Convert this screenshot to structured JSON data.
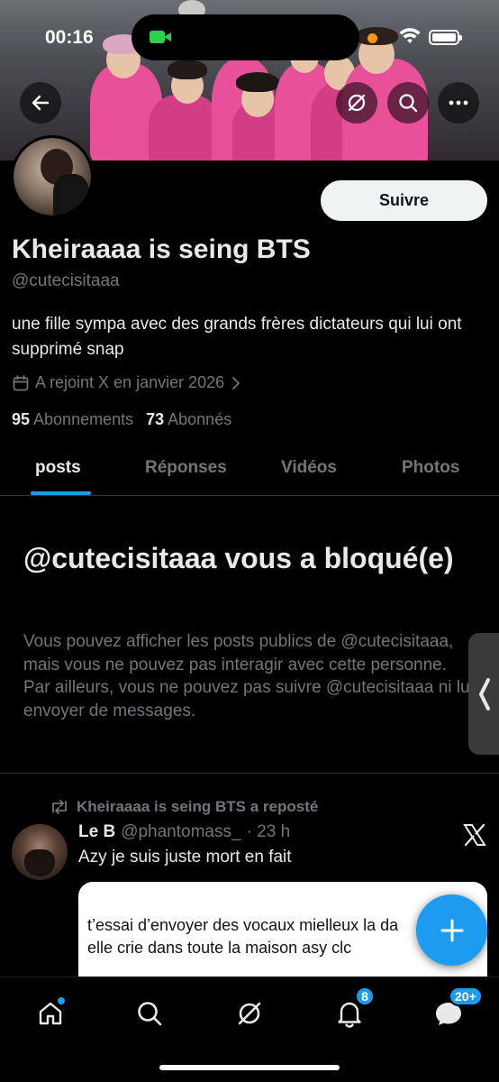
{
  "status_bar": {
    "time": "00:16"
  },
  "profile": {
    "display_name": "Kheiraaaa is seing BTS",
    "handle": "@cutecisitaaa",
    "bio": "une fille sympa avec des grands frères dictateurs qui lui ont supprimé snap",
    "joined": "A rejoint X en janvier 2026",
    "following_count": "95",
    "following_label": "Abonnements",
    "followers_count": "73",
    "followers_label": "Abonnés",
    "follow_button": "Suivre"
  },
  "tabs": [
    {
      "label": "posts",
      "active": true
    },
    {
      "label": "Réponses",
      "active": false
    },
    {
      "label": "Vidéos",
      "active": false
    },
    {
      "label": "Photos",
      "active": false
    }
  ],
  "blocked": {
    "title": "@cutecisitaaa vous a bloqué(e)",
    "text": "Vous pouvez afficher les posts publics de @cutecisitaaa, mais vous ne pouvez pas interagir avec cette personne. Par ailleurs, vous ne pouvez pas suivre @cutecisitaaa ni lui envoyer de messages."
  },
  "post": {
    "repost_label": "Kheiraaaa is seing BTS a reposté",
    "author": "Le B",
    "handle": "@phantomass_",
    "time": "· 23 h",
    "text": "Azy je suis juste mort en fait",
    "quote_text": "t’essai d’envoyer des vocaux mielleux la da\nelle crie dans toute la maison asy clc"
  },
  "bottom_nav": {
    "notifications_badge": "8",
    "messages_badge": "20+"
  },
  "colors": {
    "accent": "#1d9bf0",
    "background": "#000000",
    "muted": "#71767b",
    "text": "#e7e9ea"
  },
  "icons": [
    "back-arrow-icon",
    "grok-icon",
    "search-icon",
    "more-icon",
    "calendar-icon",
    "chevron-right-icon",
    "repost-icon",
    "x-logo-icon",
    "plus-icon",
    "home-icon",
    "bell-icon",
    "messages-icon",
    "chevron-left-icon"
  ]
}
